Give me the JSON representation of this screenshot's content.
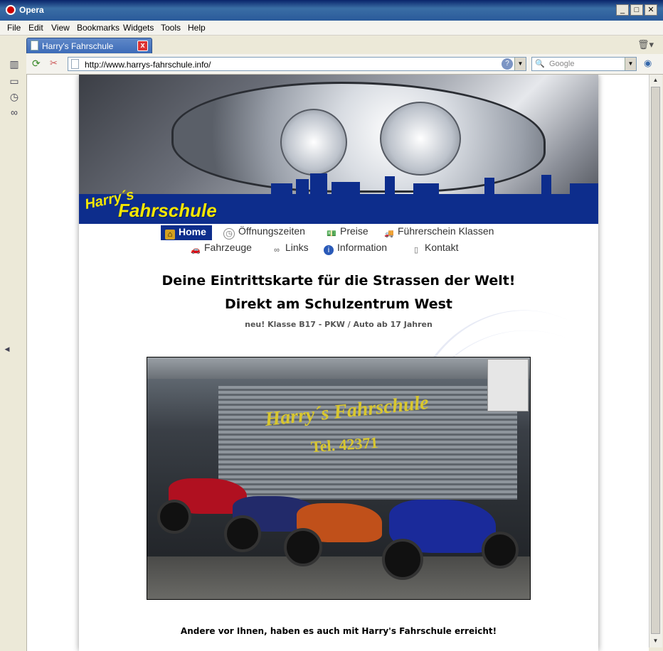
{
  "window": {
    "title": "Opera",
    "buttons": {
      "minimize": "_",
      "maximize": "□",
      "close": "✕"
    }
  },
  "menu": [
    "File",
    "Edit",
    "View",
    "Bookmarks",
    "Widgets",
    "Tools",
    "Help"
  ],
  "tab": {
    "label": "Harry's Fahrschule",
    "close": "x"
  },
  "address": {
    "url": "http://www.harrys-fahrschule.info/"
  },
  "search": {
    "placeholder": "Google"
  },
  "page": {
    "brand_top": "Harry´s",
    "brand_bottom": "Fahrschule",
    "nav": [
      {
        "label": "Home",
        "icon": "home-icon",
        "active": true
      },
      {
        "label": "Öffnungszeiten",
        "icon": "clock-icon"
      },
      {
        "label": "Preise",
        "icon": "money-icon"
      },
      {
        "label": "Führerschein Klassen",
        "icon": "truck-icon"
      },
      {
        "label": "Fahrzeuge",
        "icon": "car-icon"
      },
      {
        "label": "Links",
        "icon": "chain-link-icon"
      },
      {
        "label": "Information",
        "icon": "info-icon"
      },
      {
        "label": "Kontakt",
        "icon": "phone-icon"
      }
    ],
    "headline1": "Deine Eintrittskarte für die Strassen der Welt!",
    "headline2": "Direkt am Schulzentrum West",
    "subline": "neu! Klasse B17 - PKW / Auto ab 17 Jahren",
    "photo_sign1": "Harry´s Fahrschule",
    "photo_sign2": "Tel. 42371",
    "bottom": "Andere vor Ihnen, haben es auch mit Harry's Fahrschule erreicht!"
  }
}
